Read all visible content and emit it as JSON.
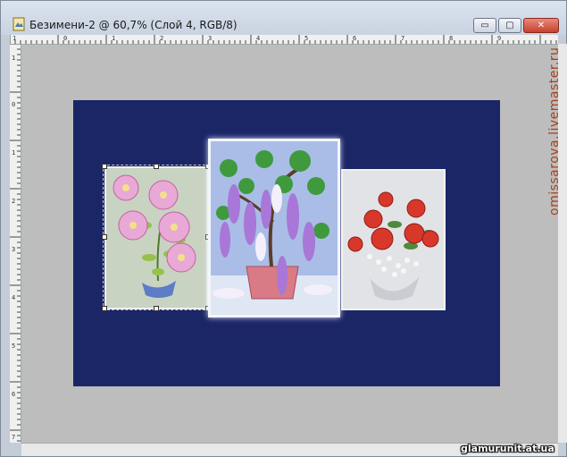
{
  "window": {
    "title": "Безимени-2 @ 60,7% (Слой 4, RGB/8)",
    "buttons": {
      "minimize": "▭",
      "maximize": "▢",
      "close": "✕"
    }
  },
  "rulers": {
    "top_labels": [
      "1",
      "0",
      "1",
      "2",
      "3",
      "4",
      "5",
      "6",
      "7",
      "8",
      "9"
    ],
    "left_labels": [
      "1",
      "0",
      "1",
      "2",
      "3",
      "4",
      "5",
      "6",
      "7"
    ]
  },
  "canvas": {
    "background_color": "#1b2667",
    "workspace_color": "#bdbdbd",
    "photos": [
      {
        "id": "left",
        "subject": "pink beaded flowers in blue pot"
      },
      {
        "id": "center",
        "subject": "purple beaded wisteria bonsai in pink pot"
      },
      {
        "id": "right",
        "subject": "red beaded roses bouquet"
      }
    ]
  },
  "watermarks": {
    "vertical": "omissarova.livemaster.ru",
    "horizontal": "glamurunit.at.ua"
  }
}
